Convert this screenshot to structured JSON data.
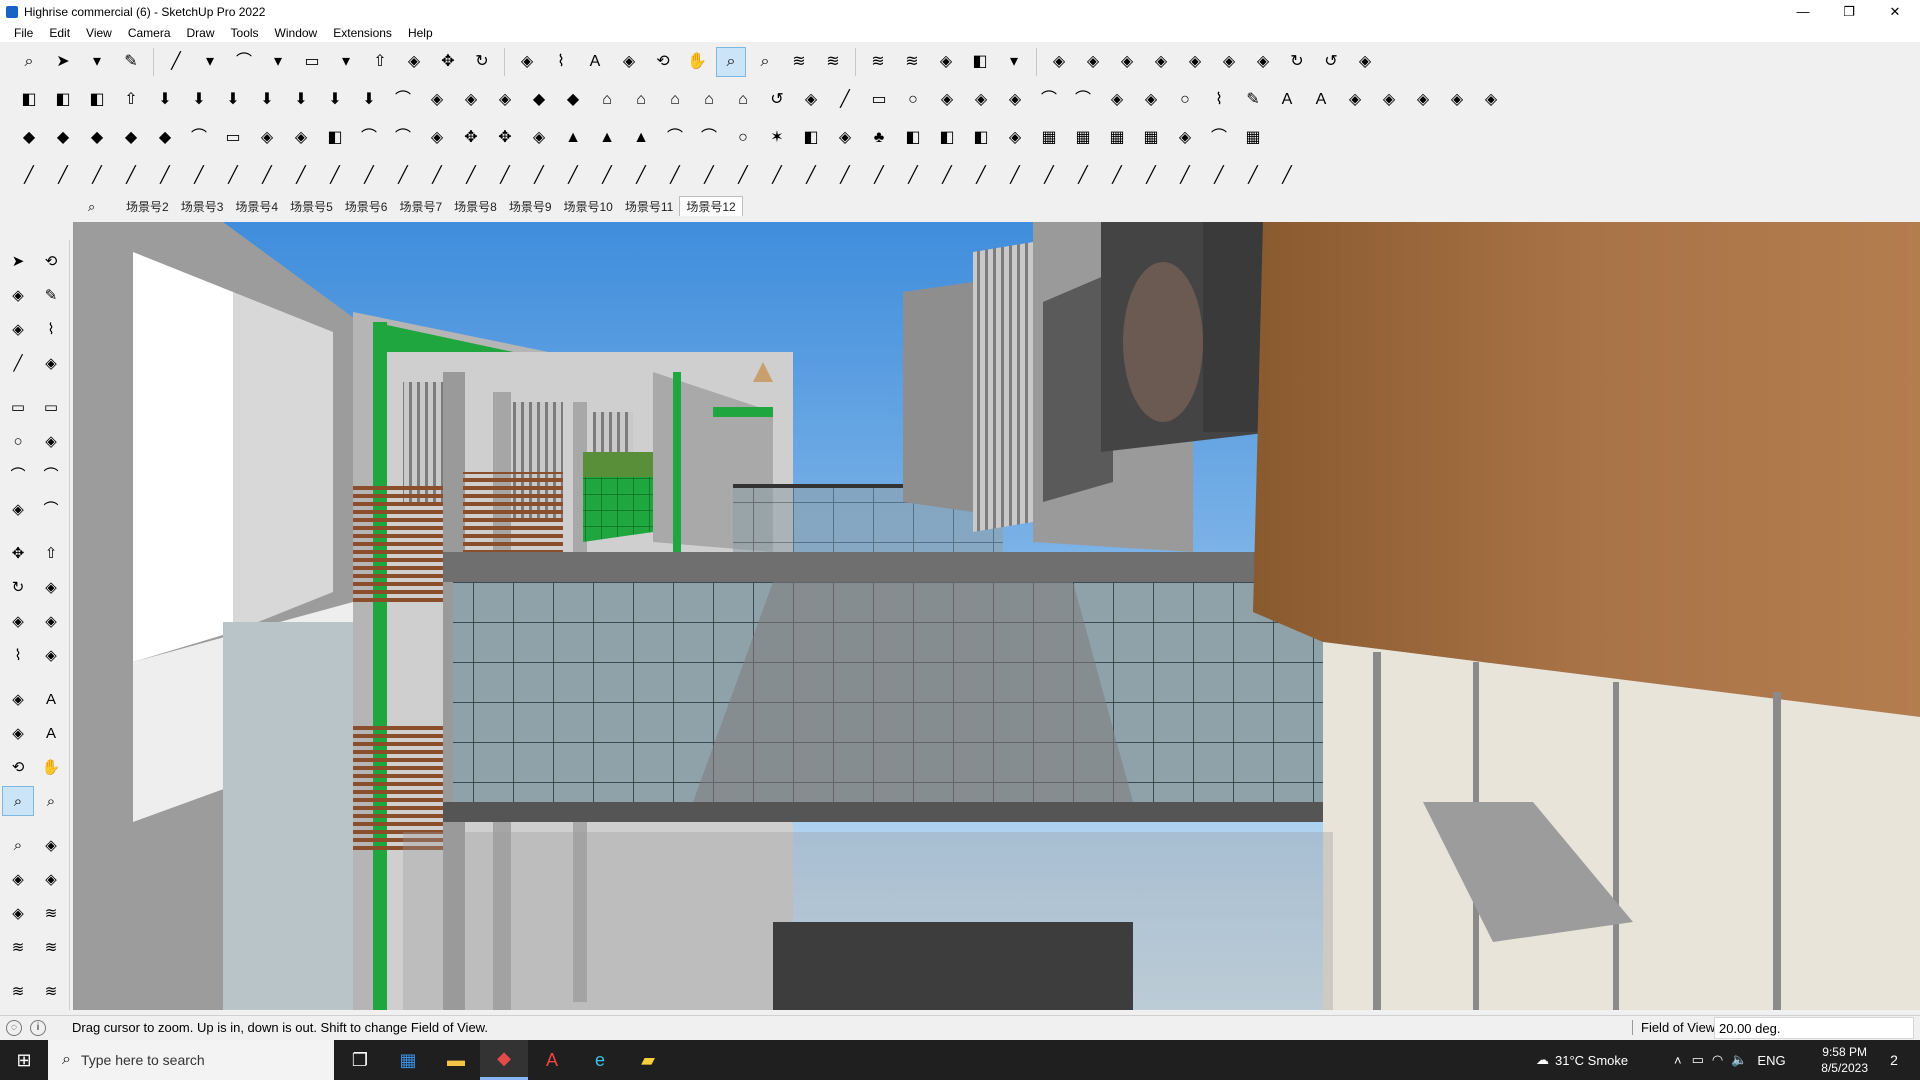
{
  "window": {
    "title": "Highrise commercial (6) - SketchUp Pro 2022",
    "minimize": "—",
    "restore": "❐",
    "close": "✕"
  },
  "menus": [
    "File",
    "Edit",
    "View",
    "Camera",
    "Draw",
    "Tools",
    "Window",
    "Extensions",
    "Help"
  ],
  "toolbar_rows": [
    [
      "zoom-extents",
      "select",
      "dropdown",
      "eraser",
      "pencil-line",
      "dropdown",
      "arc",
      "dropdown",
      "rectangle",
      "dropdown",
      "push-pull",
      "follow-me",
      "move",
      "rotate",
      "scale",
      "tape-measure",
      "text",
      "paint-bucket",
      "orbit",
      "pan",
      "zoom",
      "zoom-window",
      "section",
      "section-display",
      "section-cut",
      "layers",
      "styles",
      "sandbox",
      "dropdown",
      "component",
      "group",
      "flip",
      "align",
      "lift",
      "axes",
      "tag",
      "undo",
      "redo",
      "eyedropper"
    ],
    [
      "cube",
      "cube2",
      "cube3",
      "extrude",
      "arrow-down",
      "arrow-down2",
      "arrow-down3",
      "arrow-down4",
      "arrow-down5",
      "arrow-down6",
      "arrow-down7",
      "curve",
      "slash",
      "slash2",
      "slash3",
      "plane",
      "plane2",
      "house",
      "house2",
      "house3",
      "house4",
      "house5",
      "fredo",
      "shape",
      "pencil-red",
      "square",
      "circle",
      "hexagon",
      "ellipse",
      "parallelogram",
      "arc2",
      "spiral",
      "lasso",
      "polygon",
      "circle2",
      "ruler-red",
      "eraser-pink",
      "texture",
      "texture2",
      "warp",
      "warp2",
      "warp3",
      "warp4",
      "warp5"
    ],
    [
      "plane-blue",
      "plane-blue2",
      "plane-yellow",
      "plane-green",
      "plane-red",
      "arc-orange",
      "square-red",
      "list-red",
      "door",
      "box-brown",
      "curve2",
      "curve3",
      "dots-red",
      "cross-red",
      "cross-green",
      "x-blue",
      "cone",
      "peak",
      "triangle",
      "loop",
      "loop2",
      "circle3",
      "star",
      "box-brown2",
      "u-turn",
      "tree",
      "box2",
      "box3",
      "box4",
      "cabinet",
      "grid",
      "grid-orange",
      "grid-orange2",
      "grid-orange3",
      "dots",
      "arc3",
      "grid2"
    ],
    [
      "draw1",
      "draw2",
      "draw3",
      "draw4",
      "draw5",
      "draw6",
      "draw7",
      "draw8",
      "draw9",
      "draw10",
      "draw11",
      "draw12",
      "draw13",
      "draw14",
      "draw15",
      "draw16",
      "draw17",
      "draw18",
      "draw19",
      "draw20",
      "draw21",
      "draw22",
      "draw23",
      "draw24",
      "draw25",
      "draw26",
      "draw27",
      "draw28",
      "draw29",
      "draw30",
      "draw31",
      "draw32",
      "draw33",
      "draw34",
      "draw35",
      "draw36",
      "draw37",
      "draw38"
    ]
  ],
  "scenes": [
    "场景号2",
    "场景号3",
    "场景号4",
    "场景号5",
    "场景号6",
    "场景号7",
    "场景号8",
    "场景号9",
    "场景号10",
    "场景号11",
    "场景号12"
  ],
  "active_scene": "场景号12",
  "left_tools": [
    "select",
    "orbit",
    "paint-bucket",
    "eraser",
    "components",
    "tape",
    "line",
    "freehand",
    "rectangle",
    "rotated-rectangle",
    "circle",
    "polygon",
    "arc",
    "arc2",
    "pie",
    "arc3",
    "move",
    "push-pull",
    "rotate",
    "follow-me",
    "scale",
    "offset",
    "tape-measure",
    "dimension",
    "protractor",
    "text",
    "axes",
    "3d-text",
    "orbit2",
    "pan",
    "zoom",
    "zoom-window",
    "zoom-extents",
    "previous-view",
    "position-camera",
    "look-around",
    "walk",
    "section",
    "section2",
    "section3",
    "layers",
    "layers2"
  ],
  "status": {
    "message": "Drag cursor to zoom.  Up is in, down is out. Shift to change Field of View.",
    "vcb_label": "Field of View",
    "vcb_value": "20.00 deg."
  },
  "taskbar": {
    "search_placeholder": "Type here to search",
    "weather": "31°C  Smoke",
    "language": "ENG",
    "time": "9:58 PM",
    "date": "8/5/2023",
    "notifications": "2"
  },
  "colors": {
    "sky": "#6ea9e0",
    "accent_green": "#1fa63f",
    "wood": "#9a6a3e",
    "building_gray": "#b7b7b7"
  }
}
